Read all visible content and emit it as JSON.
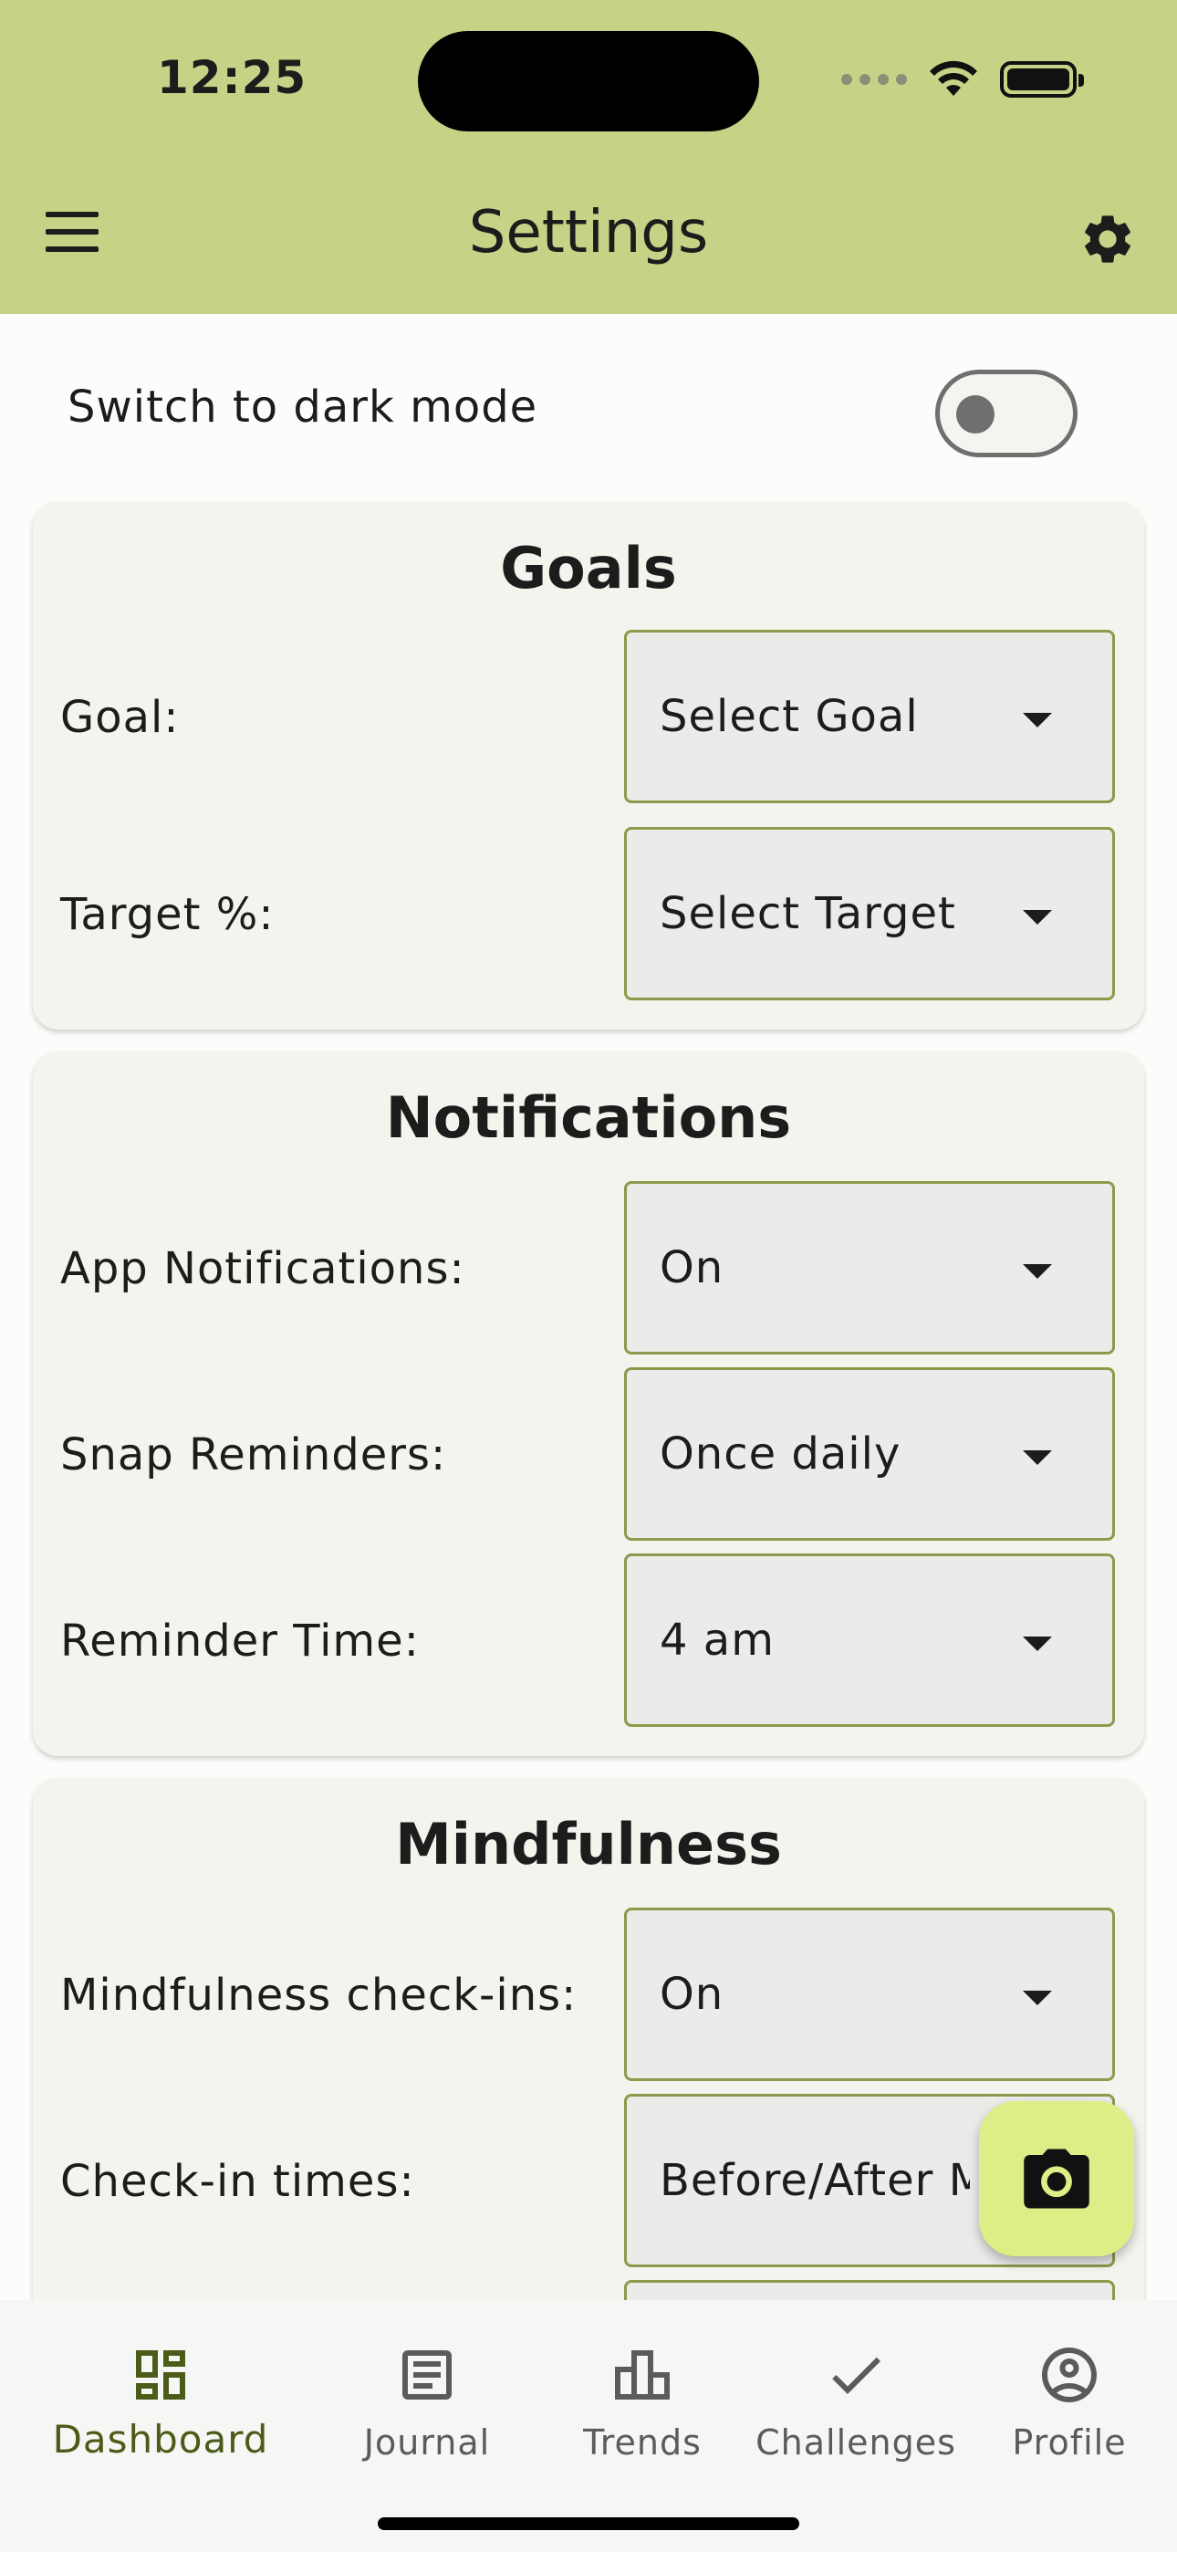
{
  "status_bar": {
    "time": "12:25"
  },
  "app_bar": {
    "title": "Settings"
  },
  "dark_mode": {
    "label": "Switch to dark mode",
    "enabled": false
  },
  "goals": {
    "title": "Goals",
    "rows": [
      {
        "label": "Goal:",
        "value": "Select Goal"
      },
      {
        "label": "Target %:",
        "value": "Select Target %"
      }
    ]
  },
  "notifications": {
    "title": "Notifications",
    "rows": [
      {
        "label": "App Notifications:",
        "value": "On"
      },
      {
        "label": "Snap Reminders:",
        "value": "Once daily"
      },
      {
        "label": "Reminder Time:",
        "value": "4 am"
      }
    ]
  },
  "mindfulness": {
    "title": "Mindfulness",
    "rows": [
      {
        "label": "Mindfulness check-ins:",
        "value": "On"
      },
      {
        "label": "Check-in times:",
        "value": "Before/After Meals"
      }
    ]
  },
  "fab": {
    "icon": "camera-icon"
  },
  "bottom_nav": {
    "items": [
      {
        "label": "Dashboard",
        "icon": "dashboard-icon",
        "active": true
      },
      {
        "label": "Journal",
        "icon": "journal-icon",
        "active": false
      },
      {
        "label": "Trends",
        "icon": "bar-chart-icon",
        "active": false
      },
      {
        "label": "Challenges",
        "icon": "check-icon",
        "active": false
      },
      {
        "label": "Profile",
        "icon": "profile-icon",
        "active": false
      }
    ]
  },
  "colors": {
    "app_bar": "#c6d386",
    "accent": "#4b5b18",
    "dropdown_border": "#8c9a4b",
    "fab": "#dcef86"
  }
}
